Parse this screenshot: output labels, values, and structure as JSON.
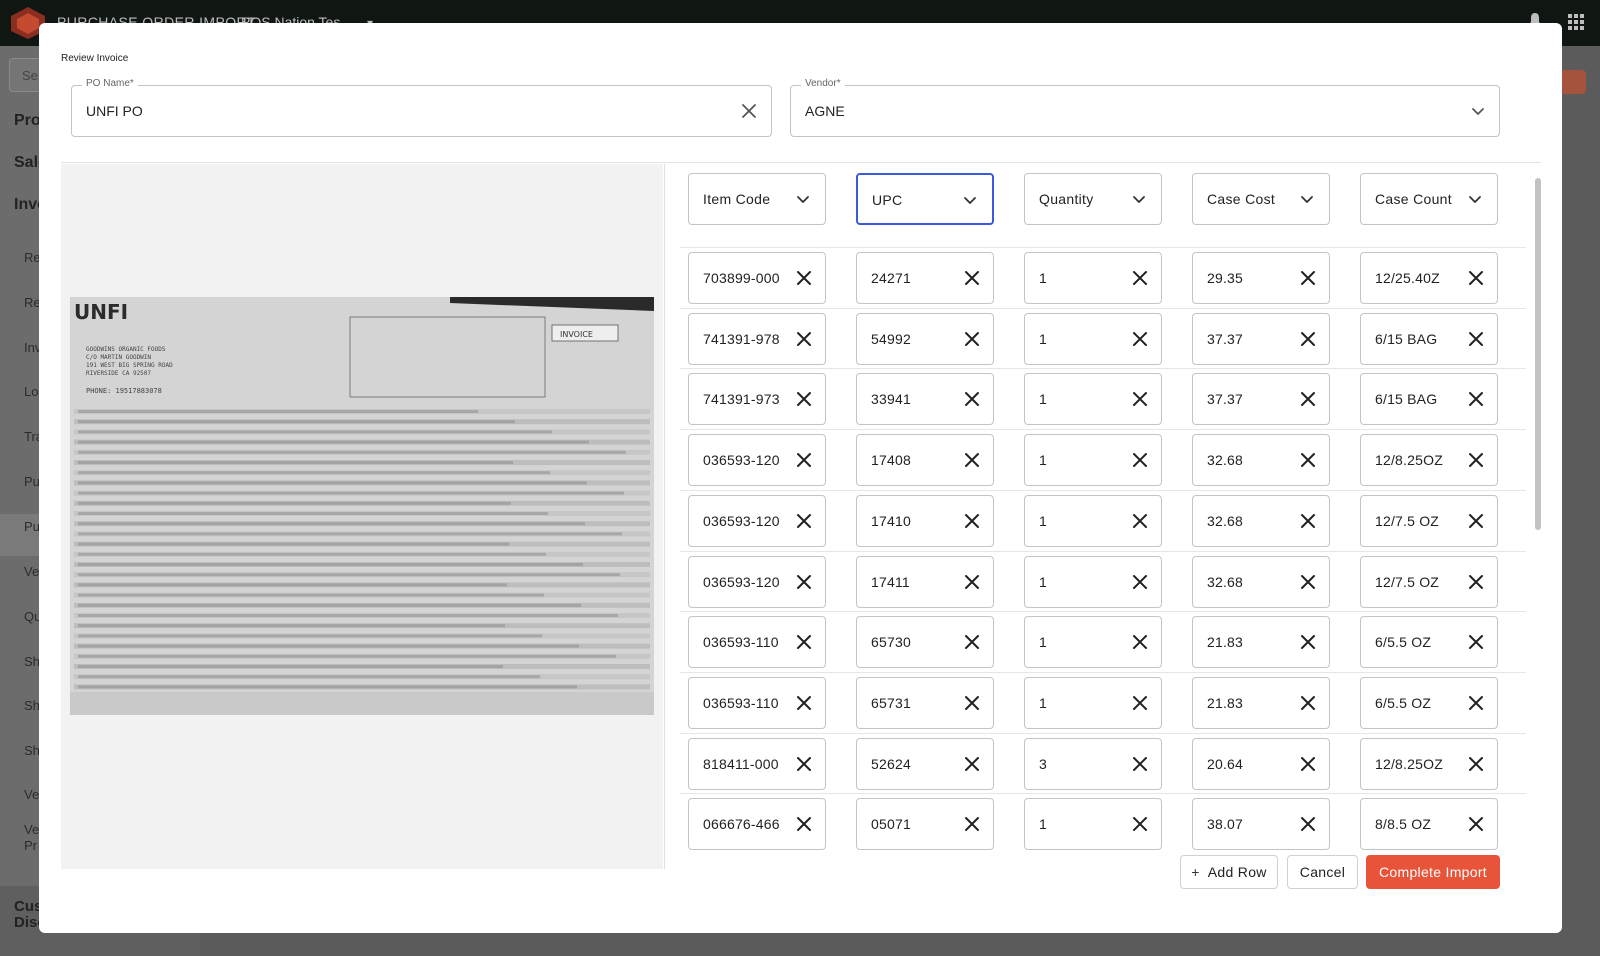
{
  "app": {
    "title": "PURCHASE ORDER IMPORT",
    "store": "POS Nation Tes",
    "search_placeholder": "Se"
  },
  "sidebar_bg": [
    {
      "label": "Pro",
      "kind": "big"
    },
    {
      "label": "Sale",
      "kind": "big"
    },
    {
      "label": "Inve",
      "kind": "big"
    },
    {
      "label": "Re",
      "kind": "sub"
    },
    {
      "label": "Re",
      "kind": "sub"
    },
    {
      "label": "Inv",
      "kind": "sub"
    },
    {
      "label": "Lo",
      "kind": "sub"
    },
    {
      "label": "Tra",
      "kind": "sub"
    },
    {
      "label": "Pu",
      "kind": "sub"
    },
    {
      "label": "Pu",
      "kind": "sub"
    },
    {
      "label": "Ve",
      "kind": "sub"
    },
    {
      "label": "Qu",
      "kind": "sub"
    },
    {
      "label": "Sh",
      "kind": "sub"
    },
    {
      "label": "Sh",
      "kind": "sub"
    },
    {
      "label": "Sh",
      "kind": "sub"
    },
    {
      "label": "Ve",
      "kind": "sub"
    },
    {
      "label": "Ve",
      "kind": "sub"
    },
    {
      "label": "Pr",
      "kind": "sub"
    }
  ],
  "sidebar_bottom": {
    "line1": "Cus",
    "line2": "Discounts"
  },
  "modal": {
    "title": "Review Invoice",
    "po_name": {
      "label": "PO Name*",
      "value": "UNFI PO"
    },
    "vendor": {
      "label": "Vendor*",
      "value": "AGNE"
    },
    "columns": [
      "Item Code",
      "UPC",
      "Quantity",
      "Case Cost",
      "Case Count"
    ],
    "rows": [
      [
        "703899-000",
        "24271",
        "1",
        "29.35",
        "12/25.40Z"
      ],
      [
        "741391-978",
        "54992",
        "1",
        "37.37",
        "6/15 BAG"
      ],
      [
        "741391-973",
        "33941",
        "1",
        "37.37",
        "6/15 BAG"
      ],
      [
        "036593-120",
        "17408",
        "1",
        "32.68",
        "12/8.25OZ"
      ],
      [
        "036593-120",
        "17410",
        "1",
        "32.68",
        "12/7.5 OZ"
      ],
      [
        "036593-120",
        "17411",
        "1",
        "32.68",
        "12/7.5 OZ"
      ],
      [
        "036593-110",
        "65730",
        "1",
        "21.83",
        "6/5.5 OZ"
      ],
      [
        "036593-110",
        "65731",
        "1",
        "21.83",
        "6/5.5 OZ"
      ],
      [
        "818411-000",
        "52624",
        "3",
        "20.64",
        "12/8.25OZ"
      ],
      [
        "066676-466",
        "05071",
        "1",
        "38.07",
        "8/8.5 OZ"
      ]
    ],
    "buttons": {
      "add_row": "Add Row",
      "cancel": "Cancel",
      "complete": "Complete Import"
    }
  },
  "invoice_image": {
    "logo": "UNFI",
    "stamp": "INVOICE",
    "phone": "PHONE: 19517883078",
    "ship_to": [
      "GOODWINS ORGANIC FOODS",
      "C/O MARTIN GOODWIN",
      "191 WEST BIG SPRING ROAD",
      "RIVERSIDE  CA  92507"
    ]
  },
  "colors": {
    "accent": "#e8543a",
    "focus": "#3b5bdb",
    "topbar": "#101713"
  },
  "icons": {
    "clear": "close-icon",
    "dropdown": "chevron-down-icon",
    "add": "plus-icon"
  }
}
